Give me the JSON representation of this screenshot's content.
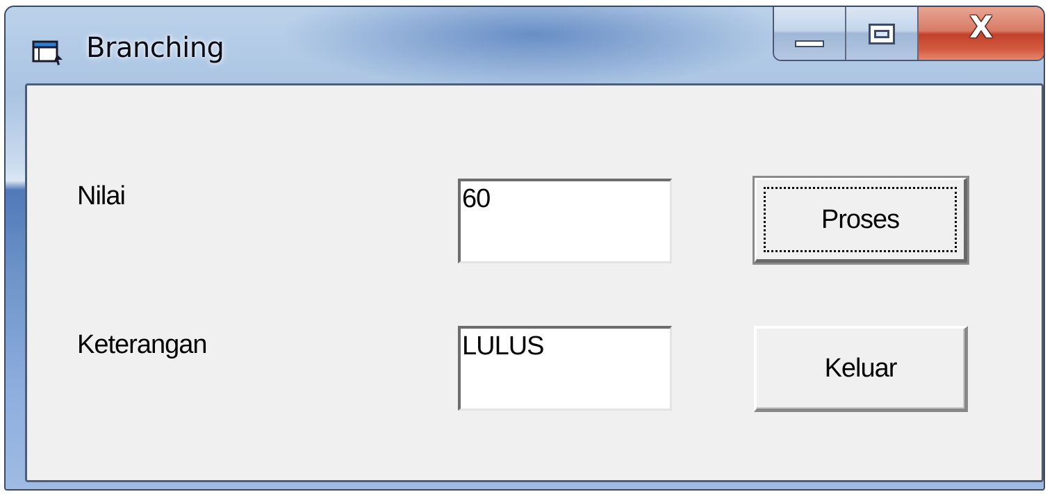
{
  "window": {
    "title": "Branching",
    "icon": "form-window-icon",
    "caption_buttons": {
      "minimize_icon": "minimize-icon",
      "maximize_icon": "maximize-icon",
      "close_glyph": "X"
    }
  },
  "form": {
    "nilai_label": "Nilai",
    "nilai_value": "60",
    "keterangan_label": "Keterangan",
    "keterangan_value": "LULUS",
    "proses_button": "Proses",
    "keluar_button": "Keluar"
  },
  "colors": {
    "client_background": "#f0f0f0",
    "titlebar_blue": "#4f79b8",
    "close_red": "#c2412a"
  }
}
